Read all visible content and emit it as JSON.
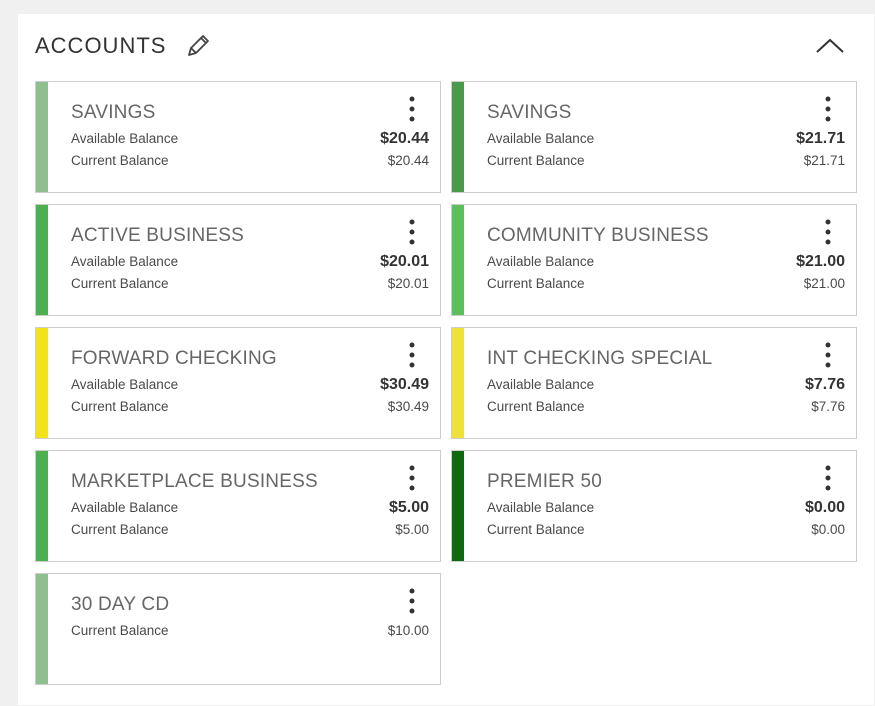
{
  "header": {
    "title": "ACCOUNTS",
    "edit_icon": "pencil-icon",
    "collapse_icon": "chevron-up-icon"
  },
  "accounts": [
    {
      "name": "SAVINGS",
      "color": "#8fbf8f",
      "available_label": "Available Balance",
      "available": "$20.44",
      "current_label": "Current Balance",
      "current": "$20.44"
    },
    {
      "name": "SAVINGS",
      "color": "#4a9a4a",
      "available_label": "Available Balance",
      "available": "$21.71",
      "current_label": "Current Balance",
      "current": "$21.71"
    },
    {
      "name": "ACTIVE BUSINESS",
      "color": "#4caf50",
      "available_label": "Available Balance",
      "available": "$20.01",
      "current_label": "Current Balance",
      "current": "$20.01"
    },
    {
      "name": "COMMUNITY BUSINESS",
      "color": "#5cbf5c",
      "available_label": "Available Balance",
      "available": "$21.00",
      "current_label": "Current Balance",
      "current": "$21.00"
    },
    {
      "name": "FORWARD CHECKING",
      "color": "#f2e21a",
      "available_label": "Available Balance",
      "available": "$30.49",
      "current_label": "Current Balance",
      "current": "$30.49"
    },
    {
      "name": "INT CHECKING SPECIAL",
      "color": "#eee23a",
      "available_label": "Available Balance",
      "available": "$7.76",
      "current_label": "Current Balance",
      "current": "$7.76"
    },
    {
      "name": "MARKETPLACE BUSINESS",
      "color": "#4caf50",
      "available_label": "Available Balance",
      "available": "$5.00",
      "current_label": "Current Balance",
      "current": "$5.00"
    },
    {
      "name": "PREMIER 50",
      "color": "#0f6a0f",
      "available_label": "Available Balance",
      "available": "$0.00",
      "current_label": "Current Balance",
      "current": "$0.00"
    },
    {
      "name": "30 DAY CD",
      "color": "#8fbf8f",
      "current_label": "Current Balance",
      "current": "$10.00"
    }
  ]
}
